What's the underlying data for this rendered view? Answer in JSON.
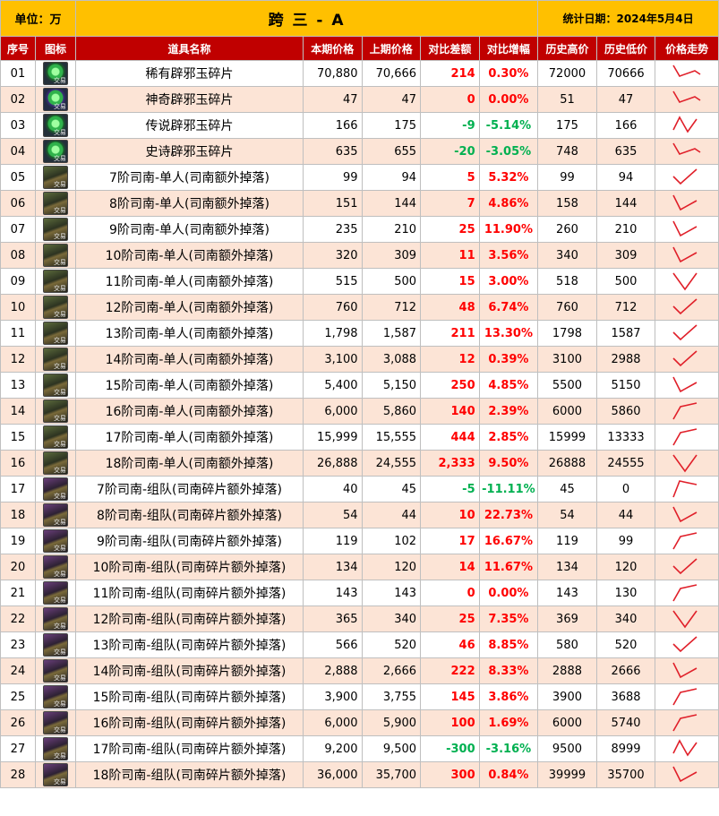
{
  "header": {
    "unit": "单位：万",
    "title": "跨 三 - A",
    "stat_date": "统计日期：2024年5月4日"
  },
  "columns": [
    "序号",
    "图标",
    "道具名称",
    "本期价格",
    "上期价格",
    "对比差额",
    "对比增幅",
    "历史高价",
    "历史低价",
    "价格走势"
  ],
  "icon_tag": "交易",
  "rows": [
    {
      "no": "01",
      "icon": "jade-icon",
      "name": "稀有辟邪玉碎片",
      "cur": "70,880",
      "prev": "70,666",
      "diff": "214",
      "pct": "0.30%",
      "high": "72000",
      "low": "70666",
      "trend": "down"
    },
    {
      "no": "02",
      "icon": "jade-icon",
      "name": "神奇辟邪玉碎片",
      "cur": "47",
      "prev": "47",
      "diff": "0",
      "pct": "0.00%",
      "high": "51",
      "low": "47",
      "trend": "down"
    },
    {
      "no": "03",
      "icon": "jade-icon",
      "name": "传说辟邪玉碎片",
      "cur": "166",
      "prev": "175",
      "diff": "-9",
      "pct": "-5.14%",
      "high": "175",
      "low": "166",
      "trend": "updown"
    },
    {
      "no": "04",
      "icon": "jade-icon",
      "name": "史诗辟邪玉碎片",
      "cur": "635",
      "prev": "655",
      "diff": "-20",
      "pct": "-3.05%",
      "high": "748",
      "low": "635",
      "trend": "down"
    },
    {
      "no": "05",
      "icon": "box-icon",
      "name": "7阶司南-单人(司南额外掉落)",
      "cur": "99",
      "prev": "94",
      "diff": "5",
      "pct": "5.32%",
      "high": "99",
      "low": "94",
      "trend": "vup"
    },
    {
      "no": "06",
      "icon": "box-icon",
      "name": "8阶司南-单人(司南额外掉落)",
      "cur": "151",
      "prev": "144",
      "diff": "7",
      "pct": "4.86%",
      "high": "158",
      "low": "144",
      "trend": "vdown"
    },
    {
      "no": "07",
      "icon": "box-icon",
      "name": "9阶司南-单人(司南额外掉落)",
      "cur": "235",
      "prev": "210",
      "diff": "25",
      "pct": "11.90%",
      "high": "260",
      "low": "210",
      "trend": "vdown"
    },
    {
      "no": "08",
      "icon": "box-icon",
      "name": "10阶司南-单人(司南额外掉落)",
      "cur": "320",
      "prev": "309",
      "diff": "11",
      "pct": "3.56%",
      "high": "340",
      "low": "309",
      "trend": "vdown"
    },
    {
      "no": "09",
      "icon": "box-icon",
      "name": "11阶司南-单人(司南额外掉落)",
      "cur": "515",
      "prev": "500",
      "diff": "15",
      "pct": "3.00%",
      "high": "518",
      "low": "500",
      "trend": "v"
    },
    {
      "no": "10",
      "icon": "box-icon",
      "name": "12阶司南-单人(司南额外掉落)",
      "cur": "760",
      "prev": "712",
      "diff": "48",
      "pct": "6.74%",
      "high": "760",
      "low": "712",
      "trend": "vup"
    },
    {
      "no": "11",
      "icon": "box-icon",
      "name": "13阶司南-单人(司南额外掉落)",
      "cur": "1,798",
      "prev": "1,587",
      "diff": "211",
      "pct": "13.30%",
      "high": "1798",
      "low": "1587",
      "trend": "vup"
    },
    {
      "no": "12",
      "icon": "box-icon",
      "name": "14阶司南-单人(司南额外掉落)",
      "cur": "3,100",
      "prev": "3,088",
      "diff": "12",
      "pct": "0.39%",
      "high": "3100",
      "low": "2988",
      "trend": "vup"
    },
    {
      "no": "13",
      "icon": "box-icon",
      "name": "15阶司南-单人(司南额外掉落)",
      "cur": "5,400",
      "prev": "5,150",
      "diff": "250",
      "pct": "4.85%",
      "high": "5500",
      "low": "5150",
      "trend": "vdown"
    },
    {
      "no": "14",
      "icon": "box-icon",
      "name": "16阶司南-单人(司南额外掉落)",
      "cur": "6,000",
      "prev": "5,860",
      "diff": "140",
      "pct": "2.39%",
      "high": "6000",
      "low": "5860",
      "trend": "up"
    },
    {
      "no": "15",
      "icon": "box-icon",
      "name": "17阶司南-单人(司南额外掉落)",
      "cur": "15,999",
      "prev": "15,555",
      "diff": "444",
      "pct": "2.85%",
      "high": "15999",
      "low": "13333",
      "trend": "up"
    },
    {
      "no": "16",
      "icon": "box-icon",
      "name": "18阶司南-单人(司南额外掉落)",
      "cur": "26,888",
      "prev": "24,555",
      "diff": "2,333",
      "pct": "9.50%",
      "high": "26888",
      "low": "24555",
      "trend": "v"
    },
    {
      "no": "17",
      "icon": "box-icon",
      "name": "7阶司南-组队(司南碎片额外掉落)",
      "cur": "40",
      "prev": "45",
      "diff": "-5",
      "pct": "-11.11%",
      "high": "45",
      "low": "0",
      "trend": "peakdown"
    },
    {
      "no": "18",
      "icon": "box-icon",
      "name": "8阶司南-组队(司南碎片额外掉落)",
      "cur": "54",
      "prev": "44",
      "diff": "10",
      "pct": "22.73%",
      "high": "54",
      "low": "44",
      "trend": "vdown"
    },
    {
      "no": "19",
      "icon": "box-icon",
      "name": "9阶司南-组队(司南碎片额外掉落)",
      "cur": "119",
      "prev": "102",
      "diff": "17",
      "pct": "16.67%",
      "high": "119",
      "low": "99",
      "trend": "up"
    },
    {
      "no": "20",
      "icon": "box-icon",
      "name": "10阶司南-组队(司南碎片额外掉落)",
      "cur": "134",
      "prev": "120",
      "diff": "14",
      "pct": "11.67%",
      "high": "134",
      "low": "120",
      "trend": "vup"
    },
    {
      "no": "21",
      "icon": "box-icon",
      "name": "11阶司南-组队(司南碎片额外掉落)",
      "cur": "143",
      "prev": "143",
      "diff": "0",
      "pct": "0.00%",
      "high": "143",
      "low": "130",
      "trend": "up"
    },
    {
      "no": "22",
      "icon": "box-icon",
      "name": "12阶司南-组队(司南碎片额外掉落)",
      "cur": "365",
      "prev": "340",
      "diff": "25",
      "pct": "7.35%",
      "high": "369",
      "low": "340",
      "trend": "v"
    },
    {
      "no": "23",
      "icon": "box-icon",
      "name": "13阶司南-组队(司南碎片额外掉落)",
      "cur": "566",
      "prev": "520",
      "diff": "46",
      "pct": "8.85%",
      "high": "580",
      "low": "520",
      "trend": "vup"
    },
    {
      "no": "24",
      "icon": "box-icon",
      "name": "14阶司南-组队(司南碎片额外掉落)",
      "cur": "2,888",
      "prev": "2,666",
      "diff": "222",
      "pct": "8.33%",
      "high": "2888",
      "low": "2666",
      "trend": "vdown"
    },
    {
      "no": "25",
      "icon": "box-icon",
      "name": "15阶司南-组队(司南碎片额外掉落)",
      "cur": "3,900",
      "prev": "3,755",
      "diff": "145",
      "pct": "3.86%",
      "high": "3900",
      "low": "3688",
      "trend": "up"
    },
    {
      "no": "26",
      "icon": "box-icon",
      "name": "16阶司南-组队(司南碎片额外掉落)",
      "cur": "6,000",
      "prev": "5,900",
      "diff": "100",
      "pct": "1.69%",
      "high": "6000",
      "low": "5740",
      "trend": "up"
    },
    {
      "no": "27",
      "icon": "box-icon",
      "name": "17阶司南-组队(司南碎片额外掉落)",
      "cur": "9,200",
      "prev": "9,500",
      "diff": "-300",
      "pct": "-3.16%",
      "high": "9500",
      "low": "8999",
      "trend": "updown"
    },
    {
      "no": "28",
      "icon": "box-icon",
      "name": "18阶司南-组队(司南碎片额外掉落)",
      "cur": "36,000",
      "prev": "35,700",
      "diff": "300",
      "pct": "0.84%",
      "high": "39999",
      "low": "35700",
      "trend": "vdown"
    }
  ],
  "colors": {
    "header_bg": "#ffc000",
    "column_header_bg": "#c00000",
    "even_row_bg": "#fce4d6",
    "positive": "#ff0000",
    "negative": "#00b050",
    "trend_line": "#e0202a"
  }
}
